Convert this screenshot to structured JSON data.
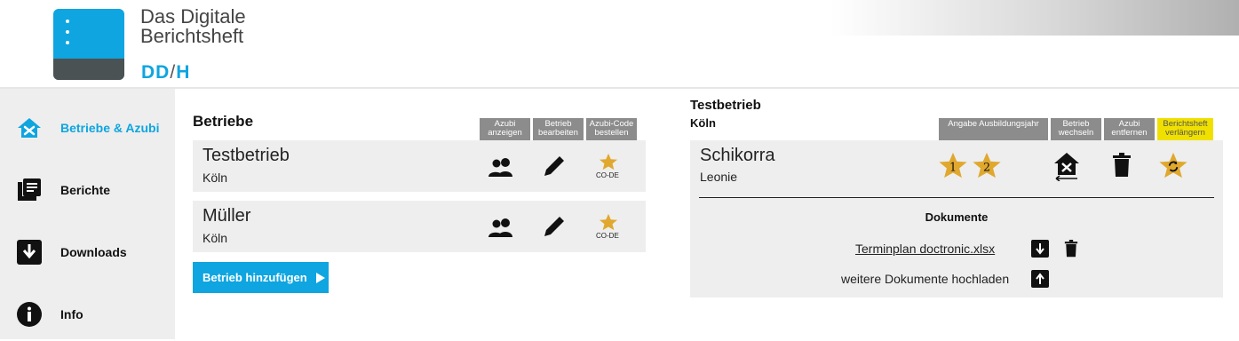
{
  "brand": {
    "line1": "Das Digitale",
    "line2": "Berichtsheft",
    "sub_a": "DD",
    "sub_slash": "/",
    "sub_b": "H"
  },
  "sidebar": {
    "items": [
      {
        "label": "Betriebe & Azubi",
        "icon": "building-tools-icon",
        "active": true
      },
      {
        "label": "Berichte",
        "icon": "reports-icon",
        "active": false
      },
      {
        "label": "Downloads",
        "icon": "download-icon",
        "active": false
      },
      {
        "label": "Info",
        "icon": "info-icon",
        "active": false
      }
    ]
  },
  "betriebe": {
    "title": "Betriebe",
    "columns": [
      "Azubi anzeigen",
      "Betrieb bearbeiten",
      "Azubi-Code bestellen"
    ],
    "rows": [
      {
        "name": "Testbetrieb",
        "city": "Köln",
        "code_label": "CO-DE"
      },
      {
        "name": "Müller",
        "city": "Köln",
        "code_label": "CO-DE"
      }
    ],
    "add_button": "Betrieb hinzufügen"
  },
  "detail": {
    "company": "Testbetrieb",
    "city": "Köln",
    "columns": [
      "Angabe Ausbildungsjahr",
      "Betrieb wechseln",
      "Azubi entfernen",
      "Berichtsheft verlängern"
    ],
    "azubi": {
      "last_name": "Schikorra",
      "first_name": "Leonie",
      "years": [
        "1",
        "2"
      ]
    },
    "documents": {
      "title": "Dokumente",
      "file": "Terminplan doctronic.xlsx",
      "upload_text": "weitere Dokumente hochladen"
    }
  },
  "colors": {
    "accent": "#0ea5e0",
    "star": "#e0a82e",
    "highlight": "#f0e000",
    "card_bg": "#eeeeee"
  }
}
